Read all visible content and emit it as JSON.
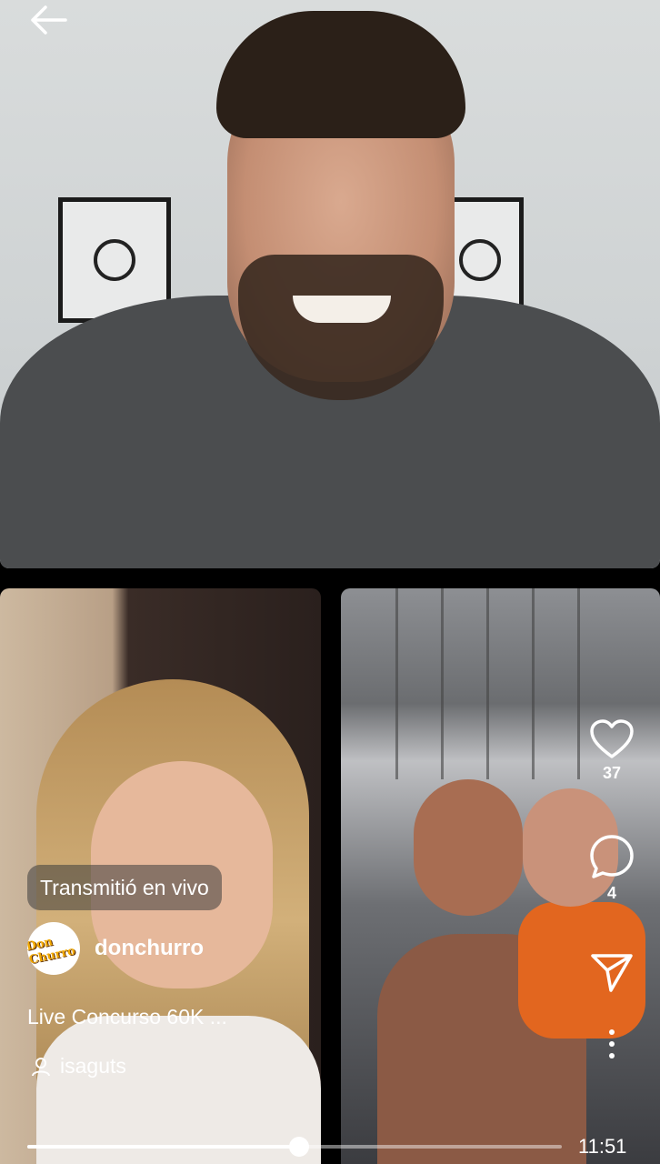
{
  "overlay": {
    "live_label": "Transmitió en vivo",
    "username": "donchurro",
    "avatar_text": "Don Churro",
    "title": "Live Concurso 60K ...",
    "viewer_name": "isaguts"
  },
  "actions": {
    "like_count": "37",
    "comment_count": "4"
  },
  "playback": {
    "progress_fraction": 0.508,
    "time": "11:51"
  },
  "icons": {
    "back": "arrow-left-icon",
    "like": "heart-icon",
    "comment": "comment-icon",
    "share": "paper-plane-icon",
    "more": "more-vertical-icon",
    "viewer": "person-icon"
  },
  "colors": {
    "accent": "#ffffff",
    "chip_bg": "rgba(60,60,60,0.55)"
  }
}
